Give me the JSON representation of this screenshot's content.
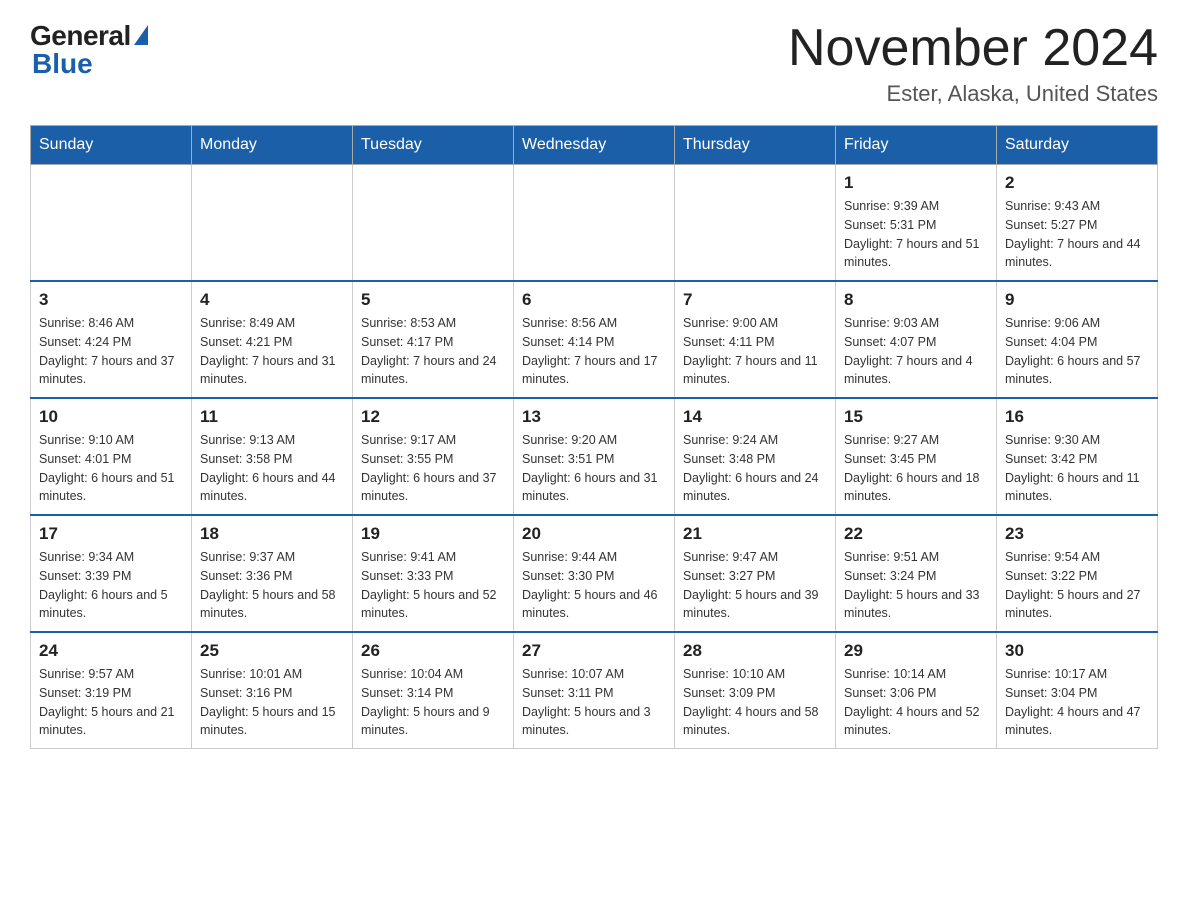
{
  "header": {
    "logo_general": "General",
    "logo_blue": "Blue",
    "month_title": "November 2024",
    "location": "Ester, Alaska, United States"
  },
  "days_of_week": [
    "Sunday",
    "Monday",
    "Tuesday",
    "Wednesday",
    "Thursday",
    "Friday",
    "Saturday"
  ],
  "weeks": [
    [
      {
        "day": "",
        "info": ""
      },
      {
        "day": "",
        "info": ""
      },
      {
        "day": "",
        "info": ""
      },
      {
        "day": "",
        "info": ""
      },
      {
        "day": "",
        "info": ""
      },
      {
        "day": "1",
        "info": "Sunrise: 9:39 AM\nSunset: 5:31 PM\nDaylight: 7 hours and 51 minutes."
      },
      {
        "day": "2",
        "info": "Sunrise: 9:43 AM\nSunset: 5:27 PM\nDaylight: 7 hours and 44 minutes."
      }
    ],
    [
      {
        "day": "3",
        "info": "Sunrise: 8:46 AM\nSunset: 4:24 PM\nDaylight: 7 hours and 37 minutes."
      },
      {
        "day": "4",
        "info": "Sunrise: 8:49 AM\nSunset: 4:21 PM\nDaylight: 7 hours and 31 minutes."
      },
      {
        "day": "5",
        "info": "Sunrise: 8:53 AM\nSunset: 4:17 PM\nDaylight: 7 hours and 24 minutes."
      },
      {
        "day": "6",
        "info": "Sunrise: 8:56 AM\nSunset: 4:14 PM\nDaylight: 7 hours and 17 minutes."
      },
      {
        "day": "7",
        "info": "Sunrise: 9:00 AM\nSunset: 4:11 PM\nDaylight: 7 hours and 11 minutes."
      },
      {
        "day": "8",
        "info": "Sunrise: 9:03 AM\nSunset: 4:07 PM\nDaylight: 7 hours and 4 minutes."
      },
      {
        "day": "9",
        "info": "Sunrise: 9:06 AM\nSunset: 4:04 PM\nDaylight: 6 hours and 57 minutes."
      }
    ],
    [
      {
        "day": "10",
        "info": "Sunrise: 9:10 AM\nSunset: 4:01 PM\nDaylight: 6 hours and 51 minutes."
      },
      {
        "day": "11",
        "info": "Sunrise: 9:13 AM\nSunset: 3:58 PM\nDaylight: 6 hours and 44 minutes."
      },
      {
        "day": "12",
        "info": "Sunrise: 9:17 AM\nSunset: 3:55 PM\nDaylight: 6 hours and 37 minutes."
      },
      {
        "day": "13",
        "info": "Sunrise: 9:20 AM\nSunset: 3:51 PM\nDaylight: 6 hours and 31 minutes."
      },
      {
        "day": "14",
        "info": "Sunrise: 9:24 AM\nSunset: 3:48 PM\nDaylight: 6 hours and 24 minutes."
      },
      {
        "day": "15",
        "info": "Sunrise: 9:27 AM\nSunset: 3:45 PM\nDaylight: 6 hours and 18 minutes."
      },
      {
        "day": "16",
        "info": "Sunrise: 9:30 AM\nSunset: 3:42 PM\nDaylight: 6 hours and 11 minutes."
      }
    ],
    [
      {
        "day": "17",
        "info": "Sunrise: 9:34 AM\nSunset: 3:39 PM\nDaylight: 6 hours and 5 minutes."
      },
      {
        "day": "18",
        "info": "Sunrise: 9:37 AM\nSunset: 3:36 PM\nDaylight: 5 hours and 58 minutes."
      },
      {
        "day": "19",
        "info": "Sunrise: 9:41 AM\nSunset: 3:33 PM\nDaylight: 5 hours and 52 minutes."
      },
      {
        "day": "20",
        "info": "Sunrise: 9:44 AM\nSunset: 3:30 PM\nDaylight: 5 hours and 46 minutes."
      },
      {
        "day": "21",
        "info": "Sunrise: 9:47 AM\nSunset: 3:27 PM\nDaylight: 5 hours and 39 minutes."
      },
      {
        "day": "22",
        "info": "Sunrise: 9:51 AM\nSunset: 3:24 PM\nDaylight: 5 hours and 33 minutes."
      },
      {
        "day": "23",
        "info": "Sunrise: 9:54 AM\nSunset: 3:22 PM\nDaylight: 5 hours and 27 minutes."
      }
    ],
    [
      {
        "day": "24",
        "info": "Sunrise: 9:57 AM\nSunset: 3:19 PM\nDaylight: 5 hours and 21 minutes."
      },
      {
        "day": "25",
        "info": "Sunrise: 10:01 AM\nSunset: 3:16 PM\nDaylight: 5 hours and 15 minutes."
      },
      {
        "day": "26",
        "info": "Sunrise: 10:04 AM\nSunset: 3:14 PM\nDaylight: 5 hours and 9 minutes."
      },
      {
        "day": "27",
        "info": "Sunrise: 10:07 AM\nSunset: 3:11 PM\nDaylight: 5 hours and 3 minutes."
      },
      {
        "day": "28",
        "info": "Sunrise: 10:10 AM\nSunset: 3:09 PM\nDaylight: 4 hours and 58 minutes."
      },
      {
        "day": "29",
        "info": "Sunrise: 10:14 AM\nSunset: 3:06 PM\nDaylight: 4 hours and 52 minutes."
      },
      {
        "day": "30",
        "info": "Sunrise: 10:17 AM\nSunset: 3:04 PM\nDaylight: 4 hours and 47 minutes."
      }
    ]
  ]
}
